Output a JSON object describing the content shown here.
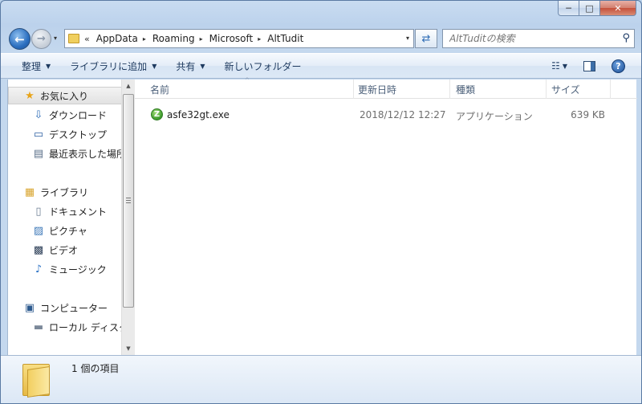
{
  "window": {
    "caption_buttons": {
      "minimize": "─",
      "maximize": "□",
      "close": "✕"
    }
  },
  "nav": {
    "back_glyph": "←",
    "forward_glyph": "→",
    "recent_glyph": "▾"
  },
  "address": {
    "chevron": "«",
    "crumbs": [
      "AppData",
      "Roaming",
      "Microsoft",
      "AltTudit"
    ],
    "separator": "▸",
    "dropdown_glyph": "▾",
    "refresh_glyph": "⇄"
  },
  "search": {
    "placeholder": "AltTuditの検索",
    "icon": "magnifier-icon",
    "icon_glyph": "⚲"
  },
  "toolbar": {
    "organize": "整理",
    "add_to_library": "ライブラリに追加",
    "share": "共有",
    "new_folder": "新しいフォルダー",
    "dropdown_glyph": "▼",
    "views_glyph": "☷",
    "help_glyph": "?"
  },
  "navpane": {
    "favorites": {
      "label": "お気に入り",
      "icon_glyph": "★"
    },
    "downloads": {
      "label": "ダウンロード",
      "icon_glyph": "⇩"
    },
    "desktop": {
      "label": "デスクトップ",
      "icon_glyph": "▭"
    },
    "recent": {
      "label": "最近表示した場所",
      "icon_glyph": "▤"
    },
    "libraries": {
      "label": "ライブラリ",
      "icon_glyph": "▦"
    },
    "documents": {
      "label": "ドキュメント",
      "icon_glyph": "▯"
    },
    "pictures": {
      "label": "ピクチャ",
      "icon_glyph": "▨"
    },
    "videos": {
      "label": "ビデオ",
      "icon_glyph": "▩"
    },
    "music": {
      "label": "ミュージック",
      "icon_glyph": "♪"
    },
    "computer": {
      "label": "コンピューター",
      "icon_glyph": "▣"
    },
    "local_disk": {
      "label": "ローカル ディスク",
      "icon_glyph": "▬"
    }
  },
  "scrollbar": {
    "up_glyph": "▲",
    "down_glyph": "▼"
  },
  "columns": {
    "name": "名前",
    "date": "更新日時",
    "type": "種類",
    "size": "サイズ",
    "sort_glyph": "^"
  },
  "files": [
    {
      "name": "asfe32gt.exe",
      "date": "2018/12/12 12:27",
      "type": "アプリケーション",
      "size": "639 KB",
      "icon_glyph": "Z"
    }
  ],
  "status": {
    "item_count": "1 個の項目"
  },
  "colors": {
    "accent": "#2f6db6",
    "toolbar_text": "#1e3a5f",
    "header_text": "#4c607a"
  }
}
